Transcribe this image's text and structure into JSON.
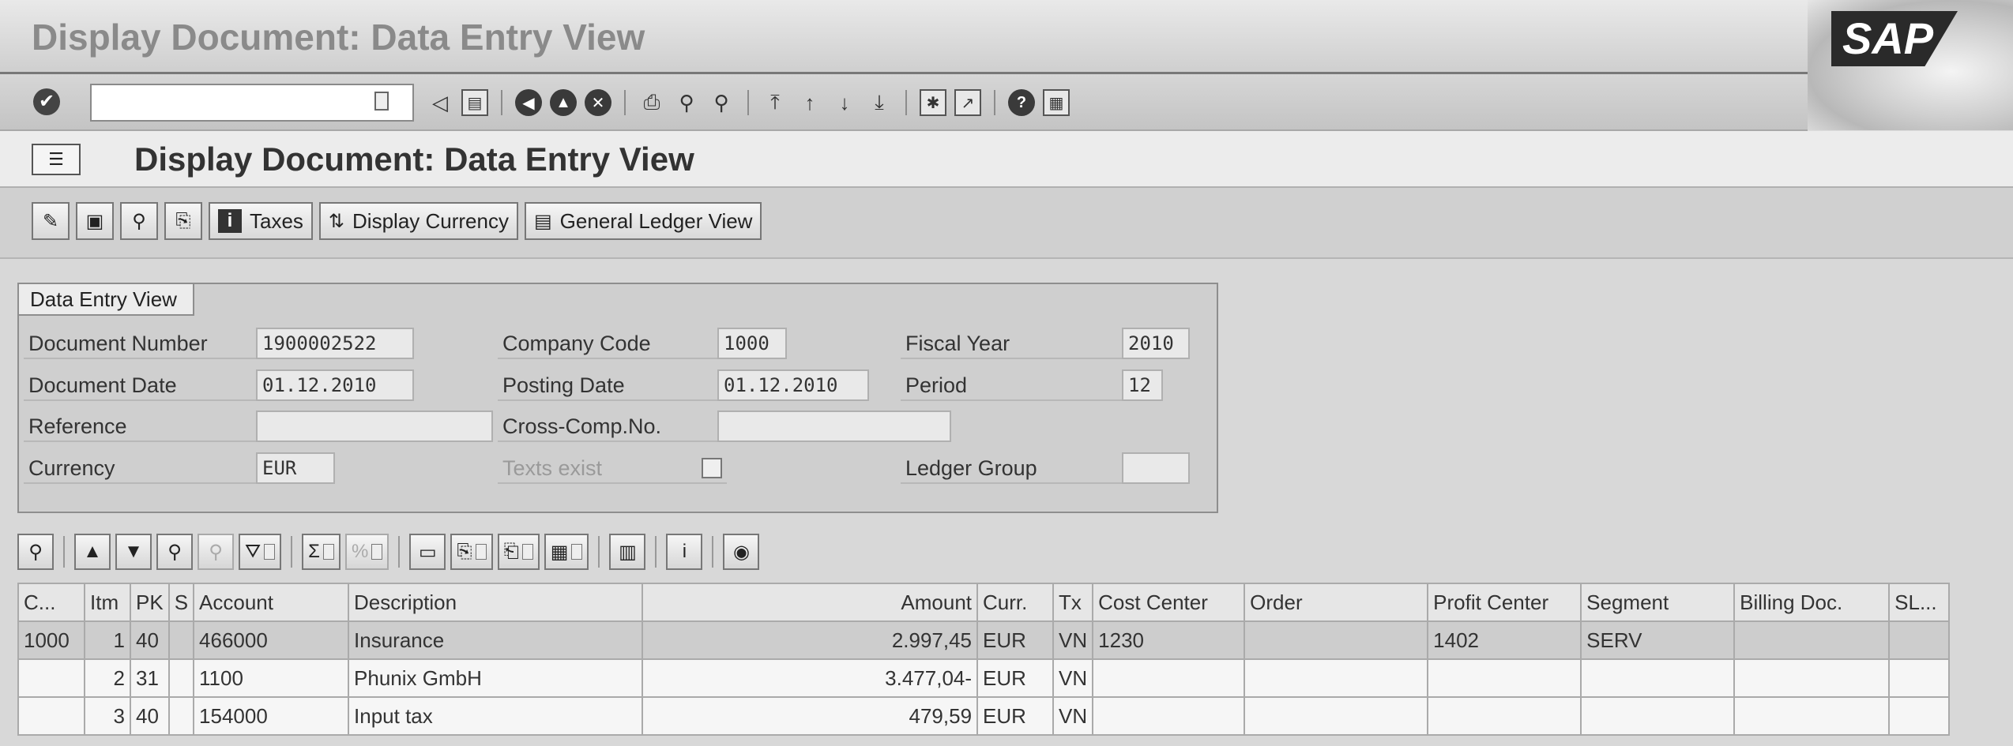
{
  "window": {
    "title": "Display Document: Data Entry View",
    "logo": "SAP"
  },
  "std_toolbar": {
    "command_value": "",
    "icons": [
      "enter-icon",
      "back-arrow-icon",
      "save-icon",
      "back-icon",
      "exit-icon",
      "cancel-icon",
      "print-icon",
      "find-icon",
      "find-next-icon",
      "first-page-icon",
      "previous-page-icon",
      "next-page-icon",
      "last-page-icon",
      "new-session-icon",
      "shortcut-icon",
      "help-icon",
      "customize-layout-icon"
    ]
  },
  "screen": {
    "title": "Display Document: Data Entry View"
  },
  "app_toolbar": {
    "taxes_label": "Taxes",
    "display_currency_label": "Display Currency",
    "gl_view_label": "General Ledger View"
  },
  "group": {
    "tab_label": "Data Entry View",
    "fields": {
      "document_number": {
        "label": "Document Number",
        "value": "1900002522"
      },
      "company_code": {
        "label": "Company Code",
        "value": "1000"
      },
      "fiscal_year": {
        "label": "Fiscal Year",
        "value": "2010"
      },
      "document_date": {
        "label": "Document Date",
        "value": "01.12.2010"
      },
      "posting_date": {
        "label": "Posting Date",
        "value": "01.12.2010"
      },
      "period": {
        "label": "Period",
        "value": "12"
      },
      "reference": {
        "label": "Reference",
        "value": ""
      },
      "cross_comp": {
        "label": "Cross-Comp.No.",
        "value": ""
      },
      "currency": {
        "label": "Currency",
        "value": "EUR"
      },
      "texts_exist": {
        "label": "Texts exist"
      },
      "ledger_group": {
        "label": "Ledger Group",
        "value": ""
      }
    }
  },
  "table": {
    "headers": {
      "c": "C...",
      "itm": "Itm",
      "pk": "PK",
      "s": "S",
      "account": "Account",
      "description": "Description",
      "amount": "Amount",
      "curr": "Curr.",
      "tx": "Tx",
      "cost_center": "Cost Center",
      "order": "Order",
      "profit_center": "Profit Center",
      "segment": "Segment",
      "billing_doc": "Billing Doc.",
      "sl": "SL..."
    },
    "rows": [
      {
        "c": "1000",
        "itm": "1",
        "pk": "40",
        "s": "",
        "account": "466000",
        "description": "Insurance",
        "amount": "2.997,45",
        "curr": "EUR",
        "tx": "VN",
        "cost_center": "1230",
        "order": "",
        "profit_center": "1402",
        "segment": "SERV",
        "billing_doc": "",
        "sl": ""
      },
      {
        "c": "",
        "itm": "2",
        "pk": "31",
        "s": "",
        "account": "1100",
        "description": "Phunix GmbH",
        "amount": "3.477,04-",
        "curr": "EUR",
        "tx": "VN",
        "cost_center": "",
        "order": "",
        "profit_center": "",
        "segment": "",
        "billing_doc": "",
        "sl": ""
      },
      {
        "c": "",
        "itm": "3",
        "pk": "40",
        "s": "",
        "account": "154000",
        "description": "Input tax",
        "amount": "479,59",
        "curr": "EUR",
        "tx": "VN",
        "cost_center": "",
        "order": "",
        "profit_center": "",
        "segment": "",
        "billing_doc": "",
        "sl": ""
      }
    ]
  }
}
